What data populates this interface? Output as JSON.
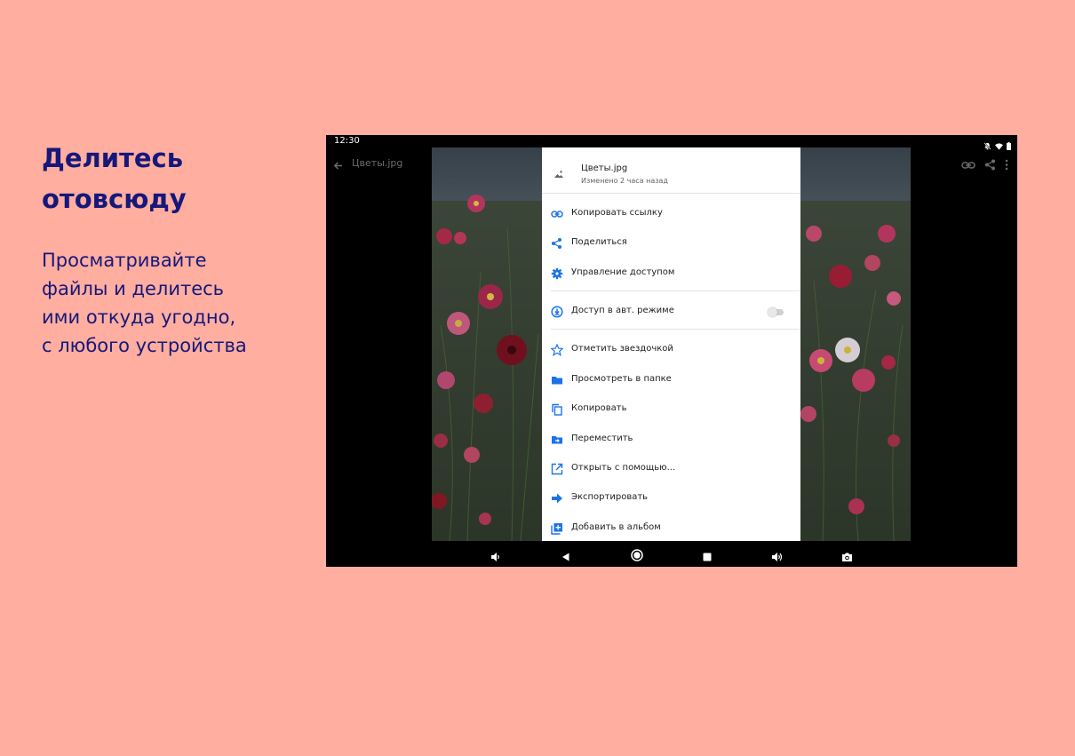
{
  "promo": {
    "title_line1": "Делитесь",
    "title_line2": "отовсюду",
    "text_line1": "Просматривайте",
    "text_line2": "файлы и делитесь",
    "text_line3": "ими откуда угодно,",
    "text_line4": "с любого устройства"
  },
  "status_bar": {
    "time": "12:30",
    "icons": [
      "notifications-off-icon",
      "wifi-icon",
      "battery-icon"
    ]
  },
  "top_bar": {
    "title": "Цветы.jpg",
    "actions": [
      "link-icon",
      "share-icon",
      "more-vert-icon"
    ]
  },
  "sheet": {
    "file_name": "Цветы.jpg",
    "file_meta": "Изменено 2 часа назад",
    "items": [
      {
        "label": "Копировать ссылку",
        "icon": "link-icon"
      },
      {
        "label": "Поделиться",
        "icon": "share-icon"
      },
      {
        "label": "Управление доступом",
        "icon": "gear-icon"
      },
      {
        "label": "Доступ в авт. режиме",
        "icon": "offline-icon",
        "toggle": false
      },
      {
        "label": "Отметить звездочкой",
        "icon": "star-icon"
      },
      {
        "label": "Просмотреть в папке",
        "icon": "folder-icon"
      },
      {
        "label": "Копировать",
        "icon": "copy-icon"
      },
      {
        "label": "Переместить",
        "icon": "move-folder-icon"
      },
      {
        "label": "Открыть с помощью...",
        "icon": "open-with-icon"
      },
      {
        "label": "Экспортировать",
        "icon": "export-icon"
      },
      {
        "label": "Добавить в альбом",
        "icon": "add-to-album-icon"
      }
    ]
  },
  "nav_bar": {
    "icons": [
      "volume-down-icon",
      "back-icon",
      "home-icon",
      "recents-icon",
      "volume-up-icon",
      "camera-icon"
    ]
  },
  "colors": {
    "background": "#ffaea0",
    "promo_text": "#15187a",
    "accent": "#1a73e8"
  }
}
